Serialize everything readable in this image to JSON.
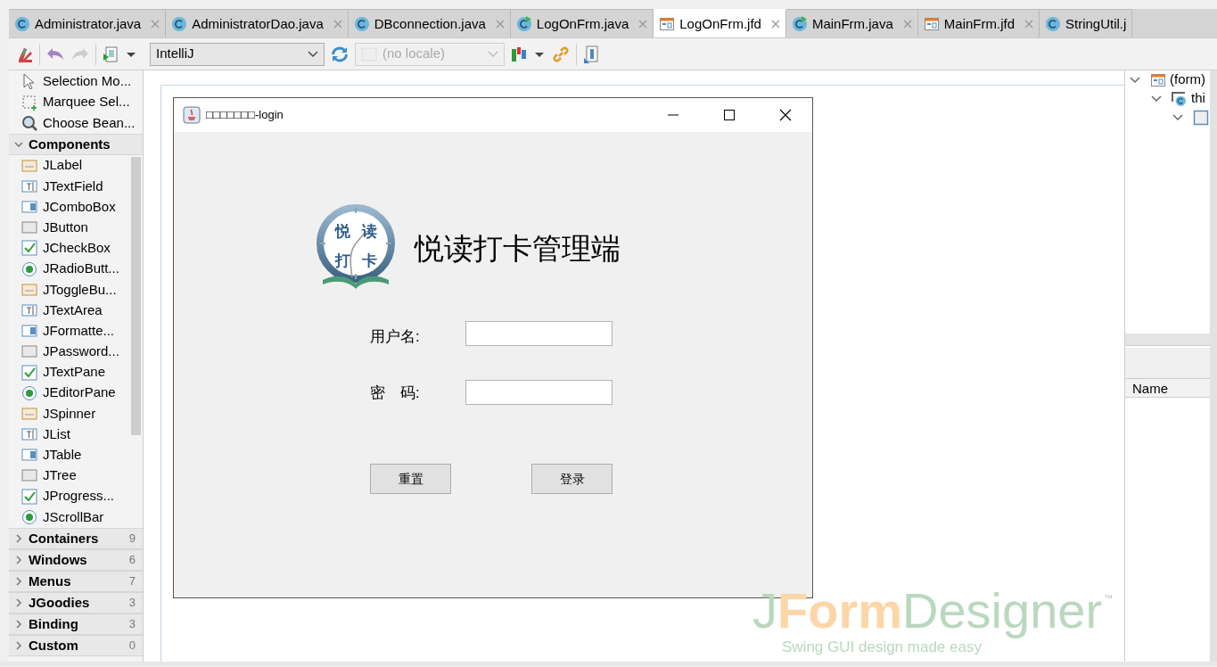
{
  "editor_tabs": [
    {
      "label": "Administrator.java",
      "kind": "class",
      "selected": false
    },
    {
      "label": "AdministratorDao.java",
      "kind": "class",
      "selected": false
    },
    {
      "label": "DBconnection.java",
      "kind": "class",
      "selected": false
    },
    {
      "label": "LogOnFrm.java",
      "kind": "runnable",
      "selected": false
    },
    {
      "label": "LogOnFrm.jfd",
      "kind": "form",
      "selected": true
    },
    {
      "label": "MainFrm.java",
      "kind": "runnable",
      "selected": false
    },
    {
      "label": "MainFrm.jfd",
      "kind": "form",
      "selected": false
    },
    {
      "label": "StringUtil.j",
      "kind": "class",
      "selected": false
    }
  ],
  "toolbar": {
    "look_and_feel": "IntelliJ",
    "locale": {
      "value": "(no locale)",
      "disabled": true
    }
  },
  "palette": {
    "tools": [
      "Selection Mo...",
      "Marquee Sel...",
      "Choose Bean..."
    ],
    "categories": [
      {
        "name": "Components",
        "expanded": true,
        "items": [
          "JLabel",
          "JTextField",
          "JComboBox",
          "JButton",
          "JCheckBox",
          "JRadioButt...",
          "JToggleBu...",
          "JTextArea",
          "JFormatte...",
          "JPassword...",
          "JTextPane",
          "JEditorPane",
          "JSpinner",
          "JList",
          "JTable",
          "JTree",
          "JProgress...",
          "JScrollBar"
        ]
      },
      {
        "name": "Containers",
        "expanded": false,
        "count": "9"
      },
      {
        "name": "Windows",
        "expanded": false,
        "count": "6"
      },
      {
        "name": "Menus",
        "expanded": false,
        "count": "7"
      },
      {
        "name": "JGoodies",
        "expanded": false,
        "count": "3"
      },
      {
        "name": "Binding",
        "expanded": false,
        "count": "3"
      },
      {
        "name": "Custom",
        "expanded": false,
        "count": "0"
      }
    ]
  },
  "form_window": {
    "title": "□□□□□□□-login",
    "logo": {
      "chars": [
        "悦",
        "读",
        "打",
        "卡"
      ]
    },
    "heading": "悦读打卡管理端",
    "fields": [
      {
        "label": "用户名:"
      },
      {
        "label": "密　码:"
      }
    ],
    "buttons": [
      "重置",
      "登录"
    ]
  },
  "branding": {
    "j": "J",
    "form": "Form",
    "designer": "Designer",
    "tm": "™",
    "tagline": "Swing GUI design made easy"
  },
  "structure_tree": [
    {
      "label": "(form)",
      "expanded": true,
      "children": [
        {
          "label": "thi",
          "expanded": true,
          "children": [
            {
              "expanded": true
            }
          ]
        }
      ]
    }
  ],
  "properties": {
    "columns": [
      "Name"
    ]
  }
}
